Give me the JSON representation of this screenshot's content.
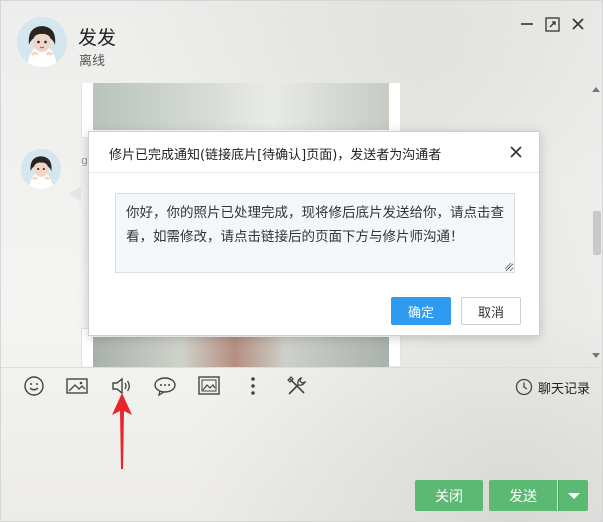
{
  "header": {
    "contact_name": "发发",
    "status": "离线"
  },
  "history": {
    "sender_id": "g"
  },
  "toolbar": {
    "history_label": "聊天记录",
    "icons": [
      "emoji-icon",
      "screenshot-icon",
      "voice-icon",
      "bubble-icon",
      "image-icon",
      "more-icon",
      "tools-icon",
      "clock-icon"
    ]
  },
  "buttons": {
    "close": "关闭",
    "send": "发送"
  },
  "dialog": {
    "title": "修片已完成通知(链接底片[待确认]页面)，发送者为沟通者",
    "message": "你好，你的照片已处理完成，现将修后底片发送给你，请点击查看，如需修改，请点击链接后的页面下方与修片师沟通！",
    "ok": "确定",
    "cancel": "取消"
  },
  "colors": {
    "green": "#5bb974",
    "blue": "#2f9bf0",
    "annotation_red": "#e8262a"
  }
}
